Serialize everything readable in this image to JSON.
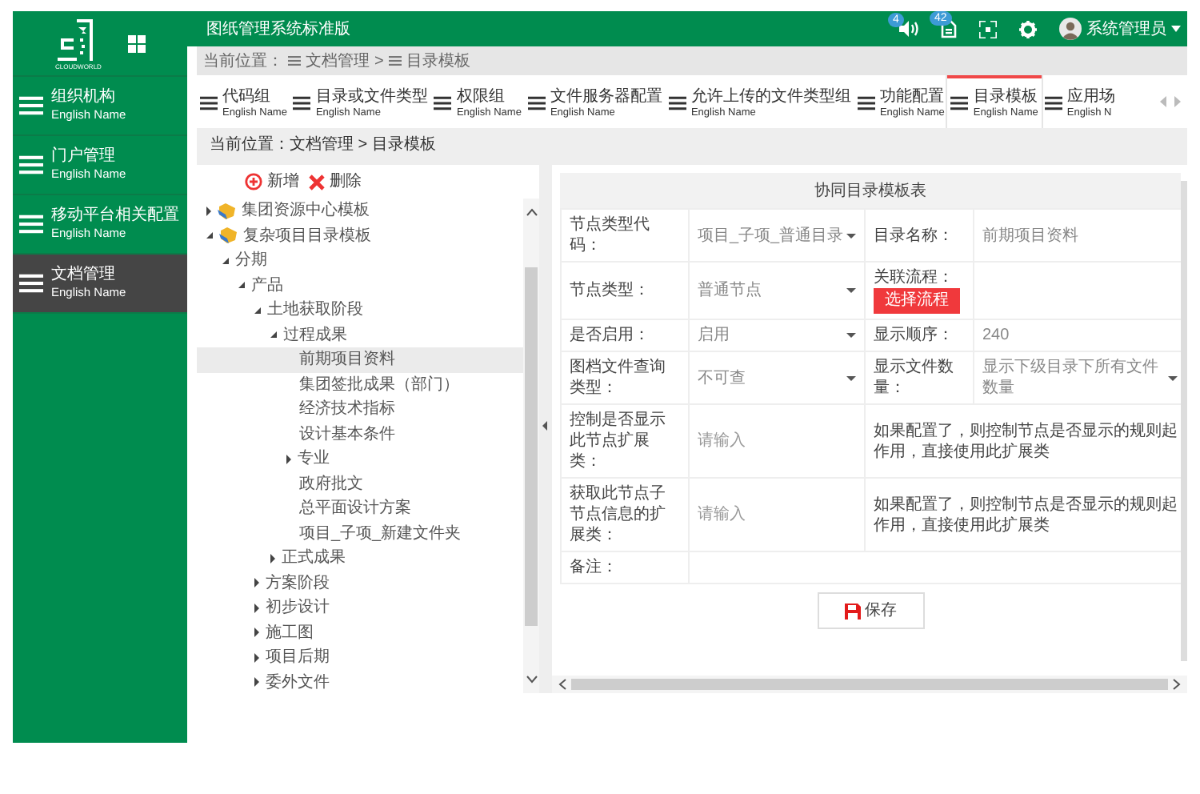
{
  "logo": {
    "caption": "CLOUDWORLD"
  },
  "header": {
    "title": "图纸管理系统标准版",
    "notifications": [
      {
        "kind": "sound",
        "count": "4"
      },
      {
        "kind": "document",
        "count": "42"
      }
    ],
    "user": "系统管理员"
  },
  "sidebar": {
    "items": [
      {
        "label": "组织机构",
        "sublabel": "English Name",
        "selected": false
      },
      {
        "label": "门户管理",
        "sublabel": "English Name",
        "selected": false
      },
      {
        "label": "移动平台相关配置",
        "sublabel": "English Name",
        "selected": false
      },
      {
        "label": "文档管理",
        "sublabel": "English Name",
        "selected": true
      }
    ]
  },
  "breadcrumb_top": {
    "prefix": "当前位置：",
    "items": [
      "文档管理",
      "目录模板"
    ],
    "separator": ">"
  },
  "tabs": [
    {
      "label": "代码组",
      "sublabel": "English Name",
      "selected": false
    },
    {
      "label": "目录或文件类型",
      "sublabel": "English Name",
      "selected": false
    },
    {
      "label": "权限组",
      "sublabel": "English Name",
      "selected": false
    },
    {
      "label": "文件服务器配置",
      "sublabel": "English Name",
      "selected": false
    },
    {
      "label": "允许上传的文件类型组",
      "sublabel": "English Name",
      "selected": false
    },
    {
      "label": "功能配置",
      "sublabel": "English Name",
      "selected": false
    },
    {
      "label": "目录模板",
      "sublabel": "English Name",
      "selected": true
    },
    {
      "label": "应用场",
      "sublabel": "English N",
      "selected": false
    }
  ],
  "breadcrumb": {
    "text": "当前位置：文档管理 > 目录模板"
  },
  "tree_toolbar": [
    {
      "kind": "add",
      "label": "新增"
    },
    {
      "kind": "delete",
      "label": "删除"
    }
  ],
  "tree": [
    {
      "kind": "template",
      "label": "集团资源中心模板",
      "expanded": false,
      "selected": false
    },
    {
      "kind": "template",
      "label": "复杂项目目录模板",
      "expanded": true,
      "selected": false,
      "children": [
        {
          "kind": "branch",
          "label": "分期",
          "expanded": true,
          "selected": false,
          "children": [
            {
              "kind": "branch",
              "label": "产品",
              "expanded": true,
              "selected": false,
              "children": [
                {
                  "kind": "branch",
                  "label": "土地获取阶段",
                  "expanded": true,
                  "selected": false,
                  "children": [
                    {
                      "kind": "branch",
                      "label": "过程成果",
                      "expanded": true,
                      "selected": false,
                      "children": [
                        {
                          "kind": "leaf",
                          "label": "前期项目资料",
                          "selected": true
                        },
                        {
                          "kind": "leaf",
                          "label": "集团签批成果（部门）",
                          "selected": false
                        },
                        {
                          "kind": "leaf",
                          "label": "经济技术指标",
                          "selected": false
                        },
                        {
                          "kind": "leaf",
                          "label": "设计基本条件",
                          "selected": false
                        },
                        {
                          "kind": "branch",
                          "label": "专业",
                          "expanded": false,
                          "selected": false
                        },
                        {
                          "kind": "leaf",
                          "label": "政府批文",
                          "selected": false
                        },
                        {
                          "kind": "leaf",
                          "label": "总平面设计方案",
                          "selected": false
                        },
                        {
                          "kind": "leaf",
                          "label": "项目_子项_新建文件夹",
                          "selected": false
                        }
                      ]
                    },
                    {
                      "kind": "branch",
                      "label": "正式成果",
                      "expanded": false,
                      "selected": false
                    }
                  ]
                },
                {
                  "kind": "branch",
                  "label": "方案阶段",
                  "expanded": false,
                  "selected": false
                },
                {
                  "kind": "branch",
                  "label": "初步设计",
                  "expanded": false,
                  "selected": false
                },
                {
                  "kind": "branch",
                  "label": "施工图",
                  "expanded": false,
                  "selected": false
                },
                {
                  "kind": "branch",
                  "label": "项目后期",
                  "expanded": false,
                  "selected": false
                },
                {
                  "kind": "branch",
                  "label": "委外文件",
                  "expanded": false,
                  "selected": false
                }
              ]
            }
          ]
        }
      ]
    }
  ],
  "form": {
    "title": "协同目录模板表",
    "rows": [
      {
        "cells": [
          {
            "kind": "label",
            "text": "节点类型代码："
          },
          {
            "kind": "select",
            "value": "项目_子项_普通目录"
          },
          {
            "kind": "label",
            "text": "目录名称："
          },
          {
            "kind": "value",
            "text": "前期项目资料"
          }
        ]
      },
      {
        "cells": [
          {
            "kind": "label",
            "text": "节点类型："
          },
          {
            "kind": "select",
            "value": "普通节点"
          },
          {
            "kind": "label_button",
            "text": "关联流程：",
            "button": "选择流程"
          },
          {
            "kind": "empty"
          }
        ]
      },
      {
        "cells": [
          {
            "kind": "label",
            "text": "是否启用："
          },
          {
            "kind": "select",
            "value": "启用"
          },
          {
            "kind": "label",
            "text": "显示顺序："
          },
          {
            "kind": "value",
            "text": "240"
          }
        ]
      },
      {
        "cells": [
          {
            "kind": "label",
            "text": "图档文件查询类型："
          },
          {
            "kind": "select",
            "value": "不可查"
          },
          {
            "kind": "label",
            "text": "显示文件数量："
          },
          {
            "kind": "select",
            "value": "显示下级目录下所有文件数量"
          }
        ]
      },
      {
        "cells": [
          {
            "kind": "label",
            "text": "控制是否显示此节点扩展类："
          },
          {
            "kind": "input",
            "placeholder": "请输入"
          },
          {
            "kind": "note",
            "text": "如果配置了，则控制节点是否显示的规则起作用，直接使用此扩展类",
            "colspan": 2
          }
        ]
      },
      {
        "cells": [
          {
            "kind": "label",
            "text": "获取此节点子节点信息的扩展类："
          },
          {
            "kind": "input",
            "placeholder": "请输入"
          },
          {
            "kind": "note",
            "text": "如果配置了，则控制节点是否显示的规则起作用，直接使用此扩展类",
            "colspan": 2
          }
        ]
      },
      {
        "cells": [
          {
            "kind": "label",
            "text": "备注："
          },
          {
            "kind": "empty",
            "colspan": 3
          }
        ]
      }
    ]
  },
  "save_button": "保存"
}
